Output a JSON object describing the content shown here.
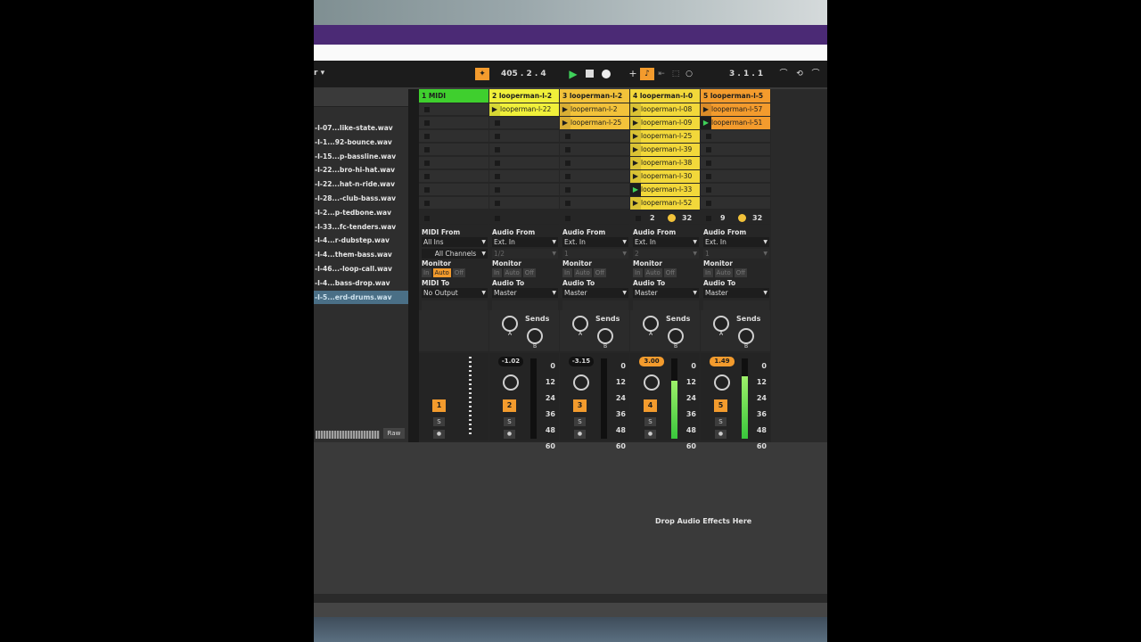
{
  "transport": {
    "bar_position": "405 .  2 .  4",
    "loop_position": "3 .  1 .  1"
  },
  "browser": {
    "items": [
      "-I-07...like-state.wav",
      "-I-1...92-bounce.wav",
      "-I-15...p-bassline.wav",
      "-I-22...bro-hi-hat.wav",
      "-I-22...hat-n-ride.wav",
      "-I-28...-club-bass.wav",
      "-I-2...p-tedbone.wav",
      "-I-33...fc-tenders.wav",
      "-I-4...r-dubstep.wav",
      "-I-4...them-bass.wav",
      "-I-46...-loop-call.wav",
      "-I-4...bass-drop.wav",
      "-I-5...erd-drums.wav"
    ],
    "raw_label": "Raw"
  },
  "tracks": [
    {
      "header": "1 MIDI",
      "header_color": "#3fcf2e",
      "clips": [],
      "input_label": "MIDI From",
      "input_value": "All Ins",
      "channel_value": "All Channels",
      "monitor_label": "Monitor",
      "monitor": [
        "In",
        "Auto",
        "Off"
      ],
      "output_label": "MIDI To",
      "output_value": "No Output",
      "number": "1",
      "volume": "",
      "solo": "S",
      "arm": "●"
    },
    {
      "header": "2 looperman-l-2",
      "header_color": "#f0f03a",
      "clips": [
        "looperman-l-22"
      ],
      "input_label": "Audio From",
      "input_value": "Ext. In",
      "channel_value": "1/2",
      "monitor_label": "Monitor",
      "monitor": [
        "In",
        "Auto",
        "Off"
      ],
      "output_label": "Audio To",
      "output_value": "Master",
      "sends_label": "Sends",
      "number": "2",
      "volume": "-1.02",
      "solo": "S",
      "arm": "●"
    },
    {
      "header": "3 looperman-l-2",
      "header_color": "#f2c23a",
      "clips": [
        "looperman-l-2",
        "looperman-l-25"
      ],
      "input_label": "Audio From",
      "input_value": "Ext. In",
      "channel_value": "1",
      "monitor_label": "Monitor",
      "monitor": [
        "In",
        "Auto",
        "Off"
      ],
      "output_label": "Audio To",
      "output_value": "Master",
      "sends_label": "Sends",
      "number": "3",
      "volume": "-3.15",
      "solo": "S",
      "arm": "●"
    },
    {
      "header": "4 looperman-l-0",
      "header_color": "#f2d83a",
      "clips": [
        "looperman-l-08",
        "looperman-l-09",
        "looperman-l-25",
        "looperman-l-39",
        "looperman-l-38",
        "looperman-l-30",
        "looperman-l-33",
        "looperman-l-52"
      ],
      "clip_status_left": "2",
      "clip_status_right": "32",
      "input_label": "Audio From",
      "input_value": "Ext. In",
      "channel_value": "2",
      "monitor_label": "Monitor",
      "monitor": [
        "In",
        "Auto",
        "Off"
      ],
      "output_label": "Audio To",
      "output_value": "Master",
      "sends_label": "Sends",
      "number": "4",
      "volume": "3.00",
      "solo": "S",
      "arm": "●"
    },
    {
      "header": "5 looperman-l-5",
      "header_color": "#f39b2d",
      "clips": [
        "looperman-l-57",
        "looperman-l-51"
      ],
      "clip_status_left": "9",
      "clip_status_right": "32",
      "input_label": "Audio From",
      "input_value": "Ext. In",
      "channel_value": "1",
      "monitor_label": "Monitor",
      "monitor": [
        "In",
        "Auto",
        "Off"
      ],
      "output_label": "Audio To",
      "output_value": "Master",
      "sends_label": "Sends",
      "number": "5",
      "volume": "1.49",
      "solo": "S",
      "arm": "●"
    }
  ],
  "meter_ticks": [
    "0",
    "12",
    "24",
    "36",
    "48",
    "60"
  ],
  "meter_levels": [
    0,
    0,
    0,
    0.72,
    0.78
  ],
  "send_labels": [
    "A",
    "B"
  ],
  "drop_hint": "Drop Audio Effects Here"
}
